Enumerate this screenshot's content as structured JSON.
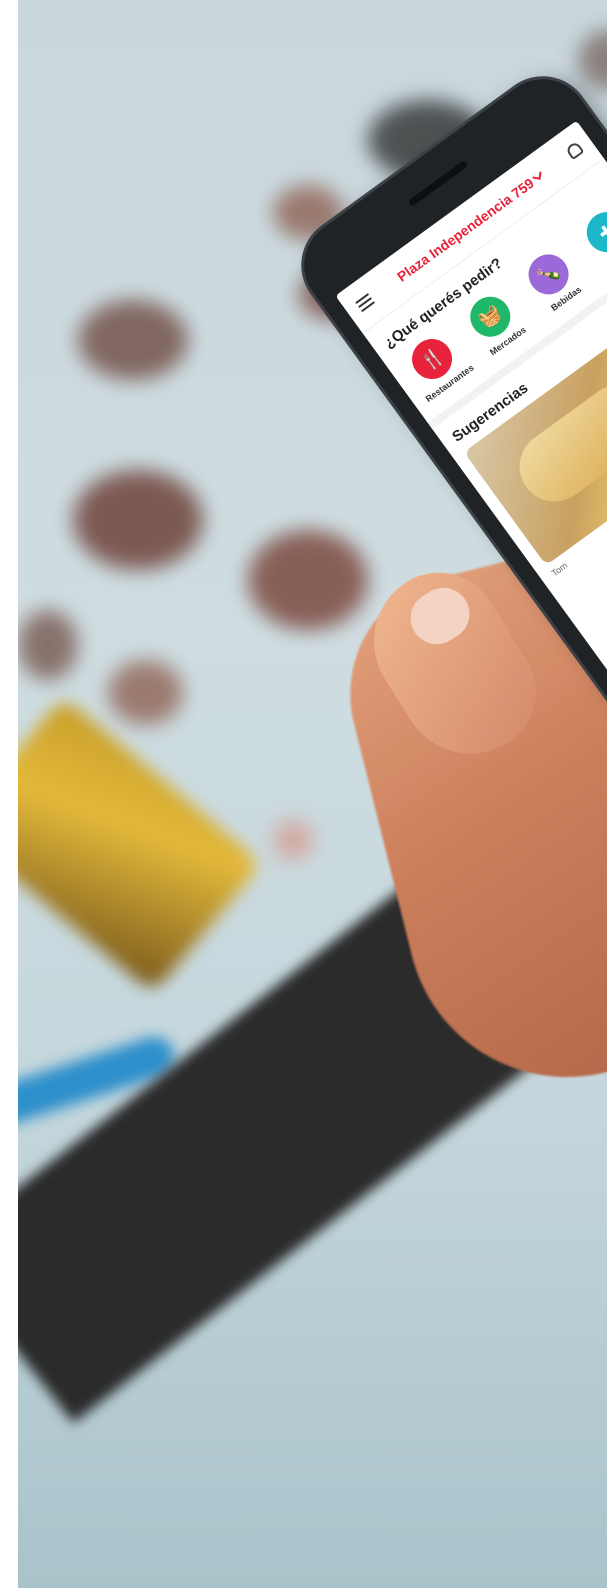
{
  "app": {
    "address": "Plaza Independencia 759",
    "question": "¿Qué querés pedir?",
    "categories": [
      {
        "label": "Restaurantes",
        "icon": "fork-knife-icon",
        "color": "#e8223a",
        "glyph": "🍴"
      },
      {
        "label": "Mercados",
        "icon": "grocery-basket-icon",
        "color": "#1fb86a",
        "glyph": "🧺"
      },
      {
        "label": "Bebidas",
        "icon": "bottles-icon",
        "color": "#9b6ad8",
        "glyph": "🍾"
      },
      {
        "label": "",
        "icon": "pharmacy-icon",
        "color": "#1cb7c9",
        "glyph": "✚"
      }
    ],
    "suggestions_title": "Sugerencias",
    "suggestion_caption": "Tom"
  }
}
